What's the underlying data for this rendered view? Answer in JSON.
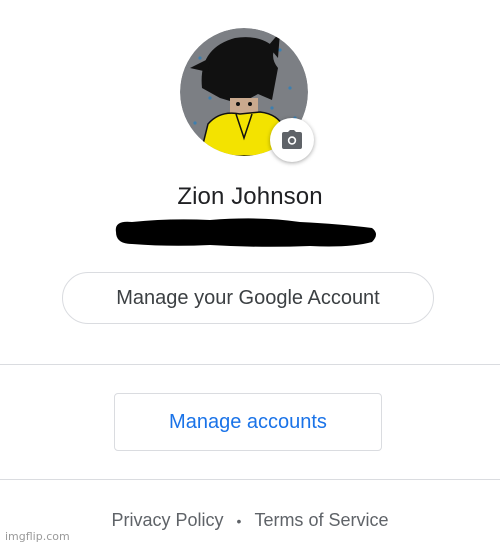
{
  "profile": {
    "name": "Zion Johnson"
  },
  "actions": {
    "manage_google_account": "Manage your Google Account",
    "manage_accounts": "Manage accounts"
  },
  "footer": {
    "privacy": "Privacy Policy",
    "separator": "•",
    "terms": "Terms of Service"
  },
  "watermark": "imgflip.com",
  "icons": {
    "change_photo": "camera-icon"
  },
  "colors": {
    "accent": "#1a73e8",
    "border": "#dadce0",
    "text_primary": "#202124",
    "text_secondary": "#5f6368"
  }
}
